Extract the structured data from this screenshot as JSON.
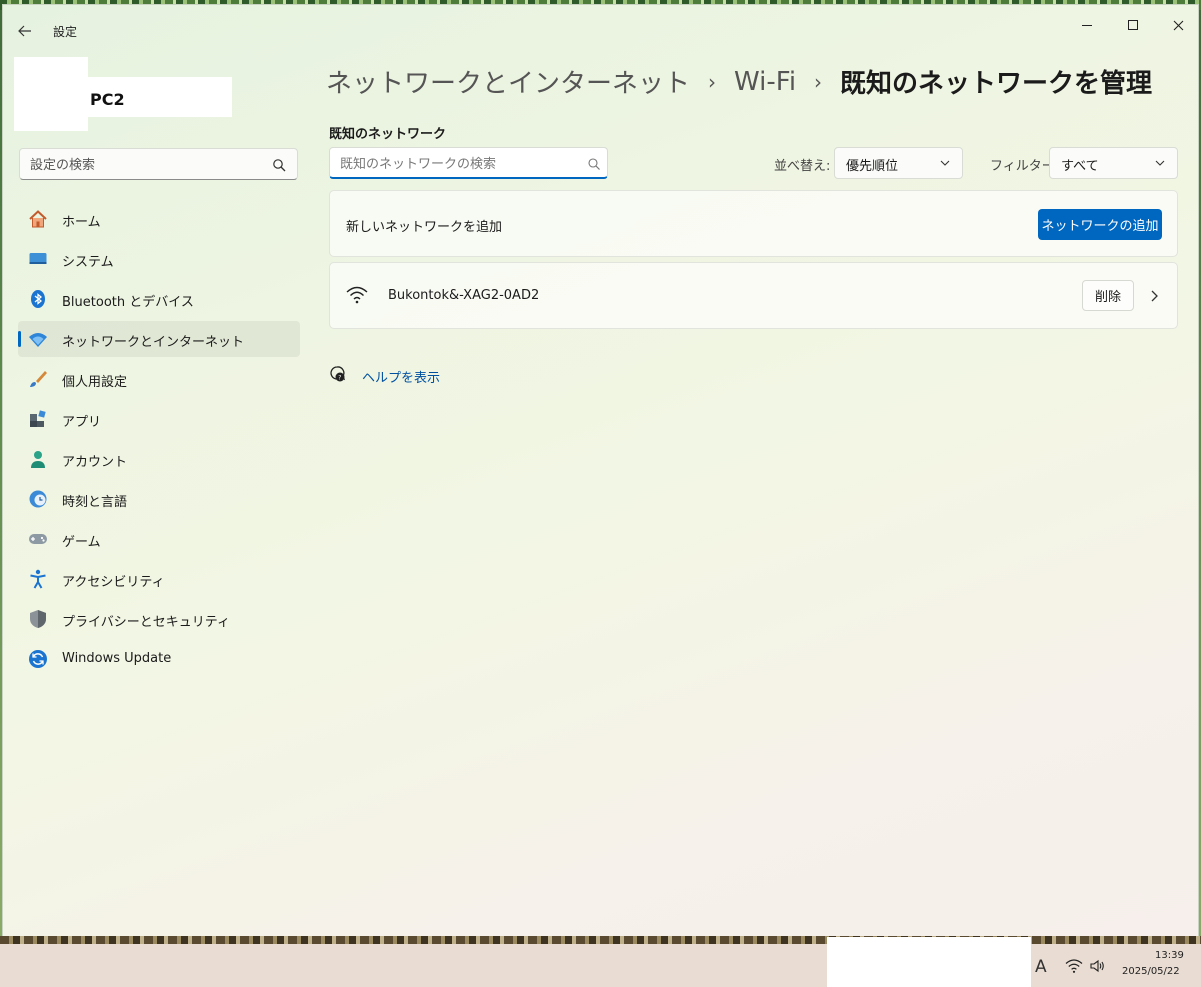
{
  "window": {
    "app_title": "設定"
  },
  "profile": {
    "name": "PC2"
  },
  "settings_search": {
    "placeholder": "設定の検索"
  },
  "sidebar": {
    "items": [
      {
        "label": "ホーム",
        "icon": "home-icon"
      },
      {
        "label": "システム",
        "icon": "system-icon"
      },
      {
        "label": "Bluetooth とデバイス",
        "icon": "bluetooth-icon"
      },
      {
        "label": "ネットワークとインターネット",
        "icon": "network-icon",
        "selected": true
      },
      {
        "label": "個人用設定",
        "icon": "brush-icon"
      },
      {
        "label": "アプリ",
        "icon": "apps-icon"
      },
      {
        "label": "アカウント",
        "icon": "account-icon"
      },
      {
        "label": "時刻と言語",
        "icon": "time-language-icon"
      },
      {
        "label": "ゲーム",
        "icon": "gamepad-icon"
      },
      {
        "label": "アクセシビリティ",
        "icon": "accessibility-icon"
      },
      {
        "label": "プライバシーとセキュリティ",
        "icon": "shield-icon"
      },
      {
        "label": "Windows Update",
        "icon": "update-icon"
      }
    ]
  },
  "header": {
    "breadcrumb": [
      "ネットワークとインターネット",
      "Wi-Fi"
    ],
    "current": "既知のネットワークを管理"
  },
  "known_networks": {
    "section_label": "既知のネットワーク",
    "search_placeholder": "既知のネットワークの検索",
    "sort_label": "並べ替え:",
    "sort_value": "優先順位",
    "filter_label": "フィルター:",
    "filter_value": "すべて",
    "add_label": "新しいネットワークを追加",
    "add_button": "ネットワークの追加",
    "networks": [
      {
        "name": "Bukontok&-XAG2-0AD2",
        "delete_label": "削除"
      }
    ]
  },
  "help": {
    "label": "ヘルプを表示"
  },
  "taskbar": {
    "ime": "A",
    "time": "13:39",
    "date": "2025/05/22"
  },
  "colors": {
    "accent": "#0067c0",
    "link": "#0050a0"
  }
}
